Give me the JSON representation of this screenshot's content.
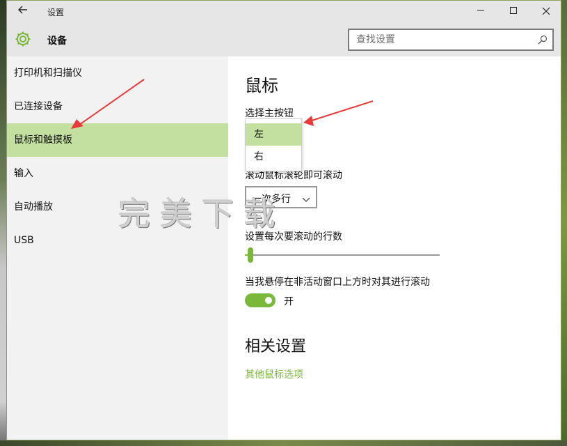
{
  "window": {
    "title": "设置"
  },
  "header": {
    "title": "设备",
    "search_placeholder": "查找设置"
  },
  "sidebar": {
    "items": [
      {
        "label": "打印机和扫描仪"
      },
      {
        "label": "已连接设备"
      },
      {
        "label": "鼠标和触摸板"
      },
      {
        "label": "输入"
      },
      {
        "label": "自动播放"
      },
      {
        "label": "USB"
      }
    ],
    "selected": "鼠标和触摸板"
  },
  "main": {
    "title": "鼠标",
    "primary_button": {
      "label": "选择主按钮",
      "options": [
        "左",
        "右"
      ],
      "selected": "左"
    },
    "scroll": {
      "label": "滚动鼠标滚轮即可滚动",
      "value": "一次多行"
    },
    "lines": {
      "label": "设置每次要滚动的行数",
      "slider_fraction": 0.03
    },
    "inactive_scroll": {
      "label": "当我悬停在非活动窗口上方时对其进行滚动",
      "toggle_on": true,
      "toggle_text": "开"
    },
    "related": {
      "title": "相关设置",
      "link": "其他鼠标选项"
    }
  },
  "watermark": "完美下载",
  "colors": {
    "accent": "#7ab83a",
    "selected_bg": "#c4e0a0",
    "arrow": "#e83a3a"
  },
  "icons": [
    "back-arrow-icon",
    "gear-icon",
    "search-icon",
    "minimize-icon",
    "maximize-icon",
    "close-icon",
    "chevron-down-icon"
  ]
}
